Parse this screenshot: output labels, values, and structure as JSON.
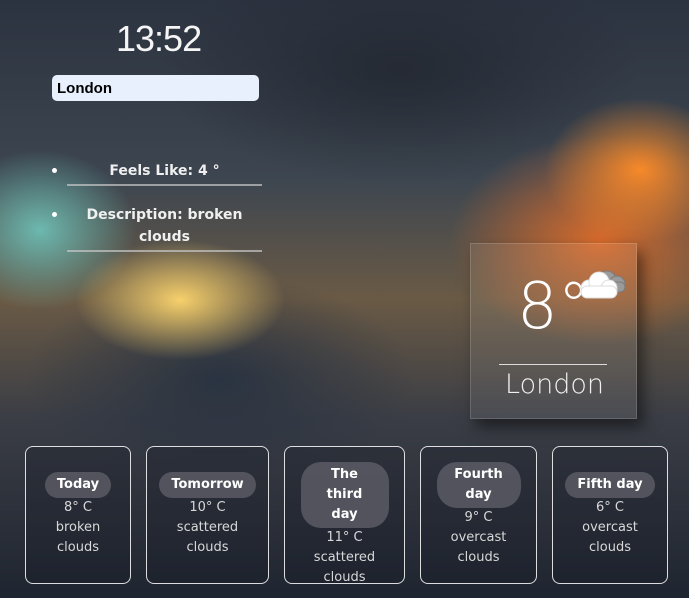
{
  "clock": "13:52",
  "search": {
    "value": "London"
  },
  "details": [
    {
      "text": "Feels Like: 4 °"
    },
    {
      "text": "Description: broken clouds"
    }
  ],
  "current": {
    "temp": "8°",
    "city": "London",
    "icon": "cloud-icon"
  },
  "forecast": [
    {
      "day": "Today",
      "temp": "8° C",
      "desc": "broken clouds"
    },
    {
      "day": "Tomorrow",
      "temp": "10° C",
      "desc": "scattered clouds"
    },
    {
      "day": "The third day",
      "temp": "11° C",
      "desc": "scattered clouds"
    },
    {
      "day": "Fourth day",
      "temp": "9° C",
      "desc": "overcast clouds"
    },
    {
      "day": "Fifth day",
      "temp": "6° C",
      "desc": "overcast clouds"
    }
  ]
}
